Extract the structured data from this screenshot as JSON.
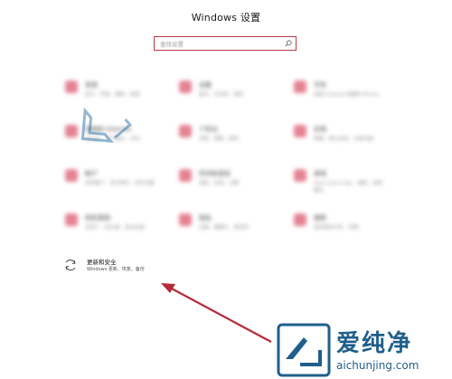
{
  "window": {
    "title": "Windows 设置"
  },
  "search": {
    "placeholder": "查找设置"
  },
  "tiles": [
    {
      "label": "系统",
      "desc": "显示、声音、通知、电源"
    },
    {
      "label": "设备",
      "desc": "蓝牙、打印机、鼠标"
    },
    {
      "label": "手机",
      "desc": "连接 Android 设备和 iPhone"
    },
    {
      "label": "网络和 Internet",
      "desc": "WLAN、飞行模式、VPN"
    },
    {
      "label": "个性化",
      "desc": "背景、锁屏、颜色"
    },
    {
      "label": "应用",
      "desc": "卸载、默认应用、可选功能"
    },
    {
      "label": "帐户",
      "desc": "你的帐户、电子邮件、同步设置"
    },
    {
      "label": "时间和语言",
      "desc": "语音、区域、日期"
    },
    {
      "label": "游戏",
      "desc": "Xbox Game Bar、捕获、游戏模式"
    },
    {
      "label": "轻松使用",
      "desc": "讲述人、放大镜、高对比度"
    },
    {
      "label": "隐私",
      "desc": "位置、摄像头、麦克风"
    },
    {
      "label": "搜索",
      "desc": "查找我的文件、权限"
    }
  ],
  "update": {
    "label": "更新和安全",
    "desc": "Windows 更新、恢复、备份"
  },
  "watermark": {
    "brand": "爱纯净",
    "site": "aichunjing.com"
  },
  "colors": {
    "accent": "#b83a4b",
    "arrow": "#b52a38",
    "watermark": "#1f5f8b"
  }
}
